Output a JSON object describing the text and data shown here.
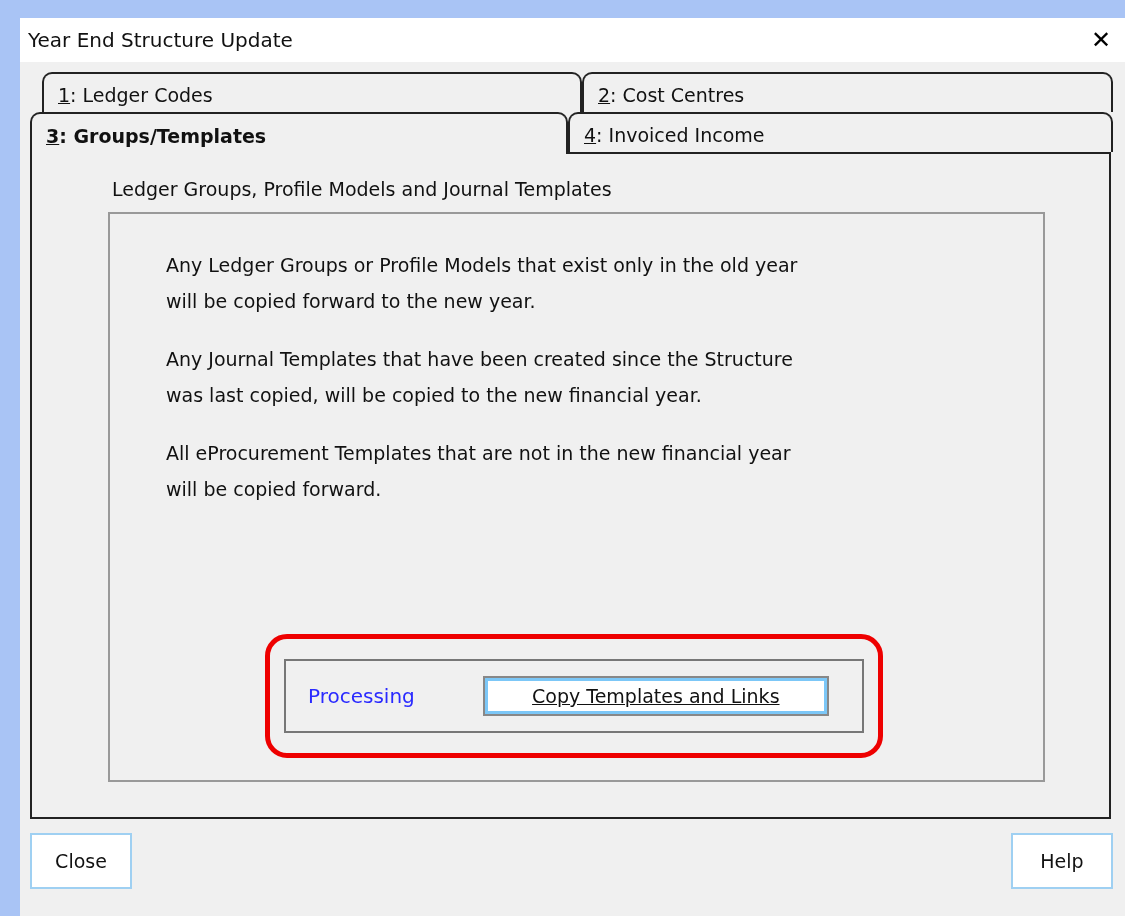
{
  "window": {
    "title": "Year End Structure Update",
    "close_glyph": "✕"
  },
  "tab_rows": [
    [
      {
        "key": "1",
        "label": ": Ledger Codes",
        "selected": false
      },
      {
        "key": "2",
        "label": ": Cost Centres",
        "selected": false
      }
    ],
    [
      {
        "key": "3",
        "label": ": Groups/Templates",
        "selected": true
      },
      {
        "key": "4",
        "label": ": Invoiced Income",
        "selected": false
      }
    ]
  ],
  "panel": {
    "heading": "Ledger Groups, Profile Models and Journal Templates",
    "paragraphs": [
      [
        "Any Ledger Groups or Profile Models that exist only in the old year",
        "will be copied forward to the new year."
      ],
      [
        "Any Journal Templates that have been created since the Structure",
        "was last copied, will be copied to the new financial year."
      ],
      [
        "All eProcurement Templates that are not in the new financial year",
        "will be copied forward."
      ]
    ],
    "processing": {
      "status": "Processing",
      "button": "Copy Templates and Links",
      "highlighted": true
    }
  },
  "buttons": [
    "Close",
    "Help"
  ]
}
